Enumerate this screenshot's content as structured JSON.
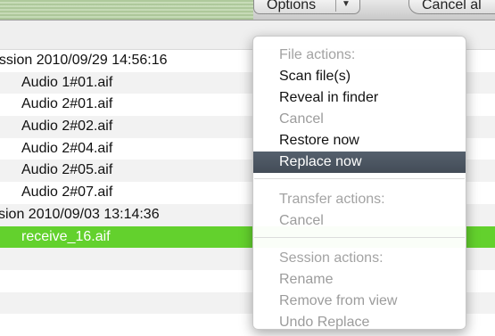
{
  "toolbar": {
    "options_label": "Options",
    "options_arrow_icon": "chevron-down-icon",
    "cancel_label": "Cancel al"
  },
  "list": {
    "rows": [
      {
        "kind": "session",
        "text": "ession 2010/09/29 14:56:16"
      },
      {
        "kind": "file",
        "text": "Audio 1#01.aif"
      },
      {
        "kind": "file",
        "text": "Audio 2#01.aif"
      },
      {
        "kind": "file",
        "text": "Audio 2#02.aif"
      },
      {
        "kind": "file",
        "text": "Audio 2#04.aif"
      },
      {
        "kind": "file",
        "text": "Audio 2#05.aif"
      },
      {
        "kind": "file",
        "text": "Audio 2#07.aif"
      },
      {
        "kind": "session",
        "text": "ssion 2010/09/03 13:14:36"
      },
      {
        "kind": "file-selected",
        "text": "receive_16.aif"
      },
      {
        "kind": "empty",
        "text": ""
      },
      {
        "kind": "empty",
        "text": ""
      },
      {
        "kind": "empty",
        "text": ""
      },
      {
        "kind": "empty",
        "text": ""
      }
    ]
  },
  "menu": {
    "file_actions_header": "File actions:",
    "scan_files": "Scan file(s)",
    "reveal_in_finder": "Reveal in finder",
    "file_cancel": "Cancel",
    "restore_now": "Restore now",
    "replace_now": "Replace now",
    "transfer_actions_header": "Transfer actions:",
    "transfer_cancel": "Cancel",
    "session_actions_header": "Session actions:",
    "rename": "Rename",
    "remove_from_view": "Remove from view",
    "undo_replace": "Undo Replace"
  },
  "colors": {
    "selection_green": "#63d12d",
    "menu_highlight": "#4b5561"
  }
}
